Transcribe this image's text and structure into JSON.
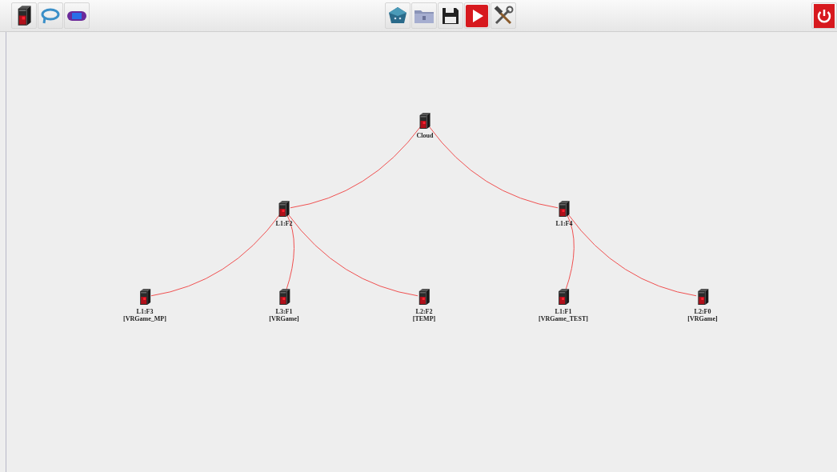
{
  "toolbar": {
    "left": [
      {
        "kind": "server"
      },
      {
        "kind": "cable"
      },
      {
        "kind": "device"
      }
    ],
    "center": [
      {
        "kind": "dice"
      },
      {
        "kind": "folder"
      },
      {
        "kind": "save"
      },
      {
        "kind": "play"
      },
      {
        "kind": "tools"
      }
    ],
    "right": [
      {
        "kind": "power"
      }
    ]
  },
  "topology": {
    "name": "Cloud",
    "children": [
      {
        "name": "L1:F2",
        "children": [
          {
            "name": "L1:F3",
            "app": "[VRGame_MP]"
          },
          {
            "name": "L3:F1",
            "app": "[VRGame]"
          },
          {
            "name": "L2:F2",
            "app": "[TEMP]"
          }
        ]
      },
      {
        "name": "L1:F4",
        "children": [
          {
            "name": "L1:F1",
            "app": "[VRGame_TEST]"
          },
          {
            "name": "L2:F0",
            "app": "[VRGame]"
          }
        ]
      }
    ]
  }
}
